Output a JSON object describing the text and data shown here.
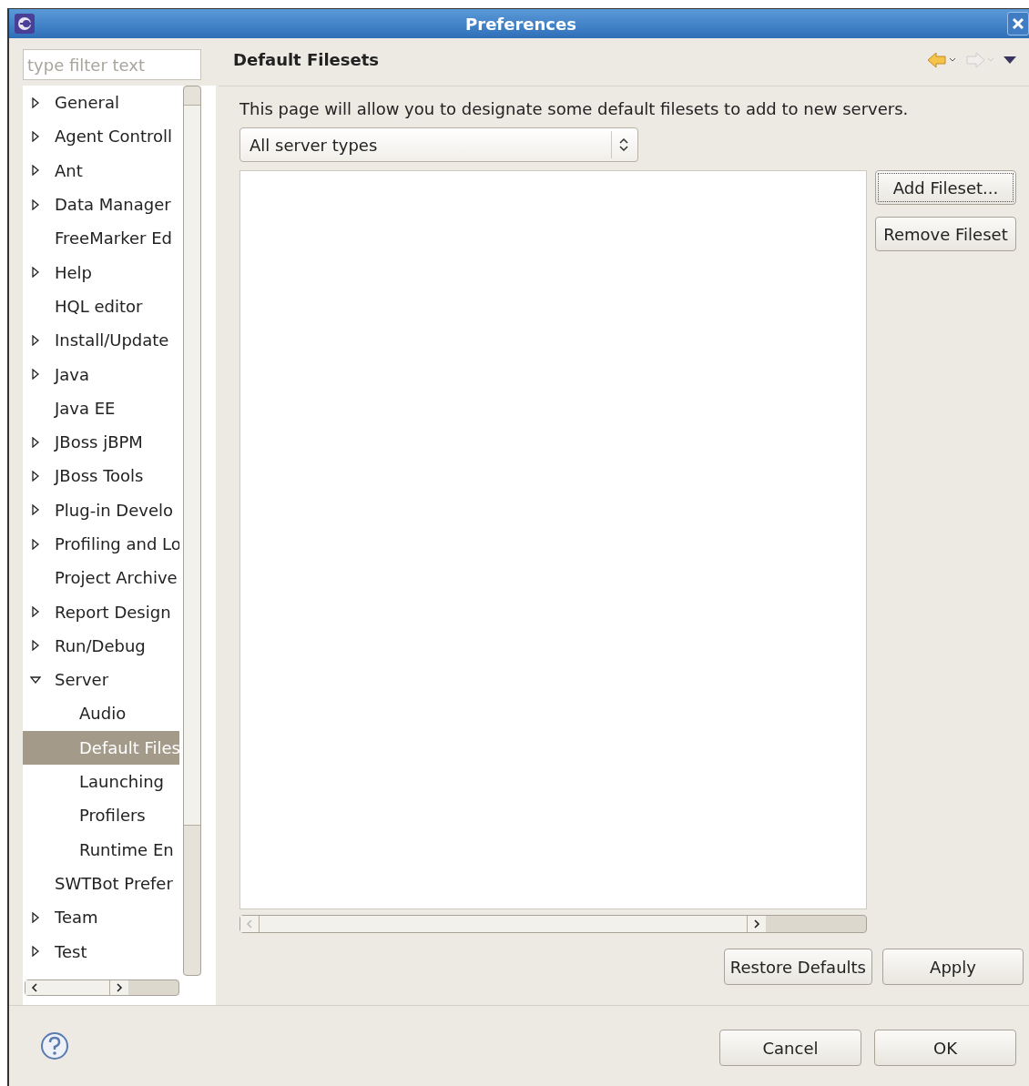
{
  "window": {
    "title": "Preferences"
  },
  "filter": {
    "placeholder": "type filter text"
  },
  "tree": [
    {
      "label": "General",
      "kind": "branch",
      "expanded": false,
      "selected": false
    },
    {
      "label": "Agent Controll",
      "kind": "branch",
      "expanded": false,
      "selected": false
    },
    {
      "label": "Ant",
      "kind": "branch",
      "expanded": false,
      "selected": false
    },
    {
      "label": "Data Manager",
      "kind": "branch",
      "expanded": false,
      "selected": false
    },
    {
      "label": "FreeMarker Ed",
      "kind": "leaf",
      "selected": false
    },
    {
      "label": "Help",
      "kind": "branch",
      "expanded": false,
      "selected": false
    },
    {
      "label": "HQL editor",
      "kind": "leaf",
      "selected": false
    },
    {
      "label": "Install/Update",
      "kind": "branch",
      "expanded": false,
      "selected": false
    },
    {
      "label": "Java",
      "kind": "branch",
      "expanded": false,
      "selected": false
    },
    {
      "label": "Java EE",
      "kind": "leaf",
      "selected": false
    },
    {
      "label": "JBoss jBPM",
      "kind": "branch",
      "expanded": false,
      "selected": false
    },
    {
      "label": "JBoss Tools",
      "kind": "branch",
      "expanded": false,
      "selected": false
    },
    {
      "label": "Plug-in Develo",
      "kind": "branch",
      "expanded": false,
      "selected": false
    },
    {
      "label": "Profiling and Lo",
      "kind": "branch",
      "expanded": false,
      "selected": false
    },
    {
      "label": "Project Archive",
      "kind": "leaf",
      "selected": false
    },
    {
      "label": "Report Design",
      "kind": "branch",
      "expanded": false,
      "selected": false
    },
    {
      "label": "Run/Debug",
      "kind": "branch",
      "expanded": false,
      "selected": false
    },
    {
      "label": "Server",
      "kind": "branch",
      "expanded": true,
      "selected": false,
      "children": [
        {
          "label": "Audio",
          "kind": "leaf",
          "selected": false
        },
        {
          "label": "Default Files",
          "kind": "leaf",
          "selected": true
        },
        {
          "label": "Launching",
          "kind": "leaf",
          "selected": false
        },
        {
          "label": "Profilers",
          "kind": "leaf",
          "selected": false
        },
        {
          "label": "Runtime En",
          "kind": "leaf",
          "selected": false
        }
      ]
    },
    {
      "label": "SWTBot Prefer",
      "kind": "leaf",
      "selected": false
    },
    {
      "label": "Team",
      "kind": "branch",
      "expanded": false,
      "selected": false
    },
    {
      "label": "Test",
      "kind": "branch",
      "expanded": false,
      "selected": false
    }
  ],
  "page": {
    "title": "Default Filesets",
    "description": "This page will allow you to designate some default filesets to add to new servers.",
    "server_type": "All server types"
  },
  "side_buttons": [
    {
      "label": "Add Fileset...",
      "focused": true
    },
    {
      "label": "Remove Fileset",
      "focused": false
    }
  ],
  "page_buttons": [
    "Restore Defaults",
    "Apply"
  ],
  "dialog_buttons": [
    "Cancel",
    "OK"
  ]
}
